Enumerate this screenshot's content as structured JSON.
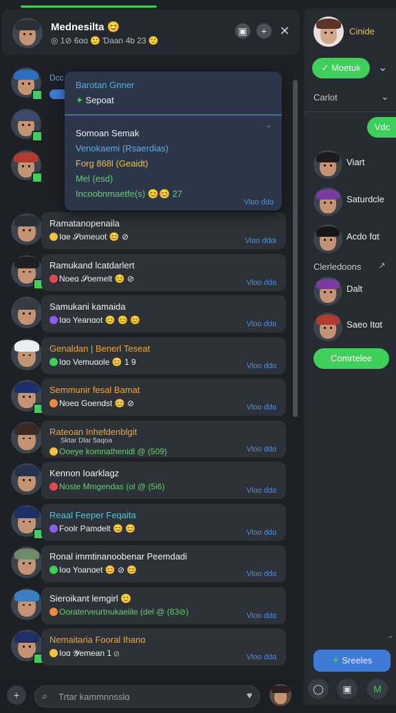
{
  "header": {
    "title": "Mednesilta",
    "title_emoji": "😊",
    "subtitle": "◎ 1⊘ 6ɑɑ 🙂 Ɗaan 4b 23 🙂",
    "icons": [
      "picture-icon",
      "plus-icon",
      "close-icon"
    ]
  },
  "dropdown": {
    "line1": "Barotan Gnner",
    "line2": "Sepoat",
    "line3": "Somoan Semak",
    "line4": "Venokaemi (Rsaerdias)",
    "line5": "Forg 868l (Geaidt)",
    "line6": "Mel (esd)",
    "line7": "Incoobnmaetfe(s) 😊😊 27",
    "footer": "Vlɑo ɗdɑ"
  },
  "conversations": [
    {
      "title": "Ramatanopenaila",
      "sub": "Iɑe 𝓢omeuot 😊 ⊘",
      "tag": "Vlɑo ɗdɑi",
      "title_color": "white",
      "sub_color": "white",
      "hat": "#2a2f36"
    },
    {
      "title": "Ramukand lcatdarlert",
      "sub": "Noeɑ 𝓢oemelt 😊 ⊘",
      "tag": "Vloo ɗdɑ",
      "title_color": "white",
      "sub_color": "white",
      "hat": "#1f1f1f"
    },
    {
      "title": "Samukani kamaida",
      "sub": "Iɑo Yeanɑot 😊 😊 😊",
      "tag": "Vloo ɗdɑ",
      "title_color": "white",
      "sub_color": "white",
      "hat": "#353b43"
    },
    {
      "title": "Genaldan | Benerl Teseat",
      "sub": "Iɑo Vemuɑole 😊 1 9",
      "tag": "Vloo ɗdɑ",
      "title_color": "orange",
      "sub_color": "white",
      "hat": "#e9eef2"
    },
    {
      "title": "Semmunir fesal Bamat",
      "sub": "Noeɑ Goendst 😊 ⊘",
      "tag": "Vloo ɗdɑ",
      "title_color": "orange",
      "sub_color": "white",
      "hat": "#1c2f6b"
    },
    {
      "title": "Rateoan Inhefdenblgit",
      "sub": "Ooeye komnathenidl @ (509)",
      "extra": "Sktar Dlar 5aqoa",
      "tag": "Vloo ɗdɑ",
      "title_color": "orange",
      "sub_color": "green",
      "hat": "#3a2a22"
    },
    {
      "title": "Kennon Ioarklagz",
      "sub": "Noste Mmgendas (ol @ (5i6)",
      "tag": "Vloo ɗdɑ",
      "title_color": "white",
      "sub_color": "green",
      "hat": "#26304f"
    },
    {
      "title": "Reaal Feeper Feqaita",
      "sub": "Foolr Pamdelt 😊 😊",
      "tag": "Vloo ɗdɑ",
      "title_color": "teal",
      "sub_color": "white",
      "hat": "#1e2e66"
    },
    {
      "title": "Ronal immtinanoobenar Peemdadi",
      "sub": "Ioɑ Yoanɑet 😊 ⊘ 😊",
      "tag": "Vloo ɗdɑ",
      "title_color": "white",
      "sub_color": "white",
      "hat": "#6d8b6a"
    },
    {
      "title": "Sieroikant lemgirl 🙂",
      "sub": "Ooraterveurtnukaeiile (del @ (83⊘)",
      "tag": "Vloo ɗdɑ",
      "title_color": "white",
      "sub_color": "green",
      "hat": "#3a7fc4"
    },
    {
      "title": "Nemaitaria Fooral Ihanɑ",
      "sub": "Ioɑ 𝓨emean 1 ⊘",
      "tag": "Vloo ɗdɑ",
      "title_color": "orange",
      "sub_color": "white",
      "hat": "#1e2e66"
    }
  ],
  "preview_rows": [
    {
      "label": "Dcc",
      "hat": "#2c6fc1"
    },
    {
      "label": "",
      "hat": "#3b4a6a"
    },
    {
      "label": "",
      "hat": "#b33a2f"
    }
  ],
  "composer": {
    "placeholder": "Trtar kammnnsslɑ"
  },
  "sidebar": {
    "profile_name": "Cinide",
    "status_button": "Moetuk",
    "section1": "Carlot",
    "tag_button": "Vdc",
    "contacts": [
      {
        "name": "Viart",
        "hat": "#1c1c1c"
      },
      {
        "name": "Saturdcle",
        "hat": "#7a3aa2"
      },
      {
        "name": "Acdo fɑt",
        "hat": "#161616"
      }
    ],
    "section2": "Clerledoons",
    "contacts2": [
      {
        "name": "Dalt",
        "hat": "#7a3aa2"
      },
      {
        "name": "Saeo Itɑt",
        "hat": "#b33a2f"
      }
    ],
    "green_button": "Comrtelee",
    "blue_button": "Sreeles"
  },
  "colors": {
    "accent_green": "#3ecf5a",
    "accent_blue": "#3e7bd6",
    "link_blue": "#4f8fdb",
    "orange": "#f0a63a"
  }
}
